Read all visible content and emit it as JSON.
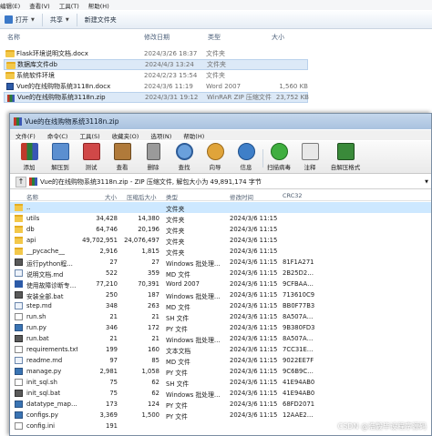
{
  "explorer": {
    "menu": [
      "编辑(E)",
      "查看(V)",
      "工具(T)",
      "帮助(H)"
    ],
    "toolbar": {
      "open": "打开",
      "share": "共享",
      "new_folder": "新建文件夹"
    },
    "columns": {
      "name": "名称",
      "date": "修改日期",
      "type": "类型",
      "size": "大小"
    },
    "rows": [
      {
        "name": "Flask环境说明文档.docx",
        "date": "2024/3/26 18:37",
        "type": "文件夹",
        "size": "",
        "icon": "folder-icon"
      },
      {
        "name": "数据库文件db",
        "date": "2024/4/3 13:24",
        "type": "文件夹",
        "size": "",
        "icon": "folder-icon"
      },
      {
        "name": "系统软件环境",
        "date": "2024/2/23 15:54",
        "type": "文件夹",
        "size": "",
        "icon": "folder-icon"
      },
      {
        "name": "Vue的在线购物系统3118n.docx",
        "date": "2024/3/6 11:19",
        "type": "Word 2007",
        "size": "1,560 KB",
        "icon": "docx-icon"
      },
      {
        "name": "Vue的在线购物系统3118n.zip",
        "date": "2024/3/31 19:12",
        "type": "WinRAR ZIP 压缩文件",
        "size": "23,752 KB",
        "icon": "zip-icon"
      }
    ]
  },
  "winrar": {
    "title": "Vue的在线购物系统3118n.zip",
    "menu": [
      "文件(F)",
      "命令(C)",
      "工具(S)",
      "收藏夹(O)",
      "选项(N)",
      "帮助(H)"
    ],
    "tools": [
      {
        "label": "添加",
        "color": "#b34a3a"
      },
      {
        "label": "解压到",
        "color": "#4f7fbf"
      },
      {
        "label": "测试",
        "color": "#c23b3b"
      },
      {
        "label": "查看",
        "color": "#9a6a2e"
      },
      {
        "label": "删除",
        "color": "#7a7a7a"
      },
      {
        "label": "查找",
        "color": "#4a7dc0"
      },
      {
        "label": "向导",
        "color": "#c88a2a"
      },
      {
        "label": "信息",
        "color": "#2f6fb3"
      },
      {
        "label": "扫描病毒",
        "color": "#3a9a3a"
      },
      {
        "label": "注释",
        "color": "#8a8a8a"
      },
      {
        "label": "自解压格式",
        "color": "#2a7a2a"
      }
    ],
    "path": "Vue的在线购物系统3118n.zip - ZIP 压缩文件, 解包大小为 49,891,174 字节",
    "columns": {
      "name": "名称",
      "size": "大小",
      "packed": "压缩后大小",
      "type": "类型",
      "modified": "修改时间",
      "crc": "CRC32"
    },
    "rows": [
      {
        "name": "..",
        "size": "",
        "packed": "",
        "type": "文件夹",
        "modified": "",
        "crc": "",
        "icon": "folder"
      },
      {
        "name": "utils",
        "size": "34,428",
        "packed": "14,380",
        "type": "文件夹",
        "modified": "2024/3/6 11:15",
        "crc": "",
        "icon": "folder"
      },
      {
        "name": "db",
        "size": "64,746",
        "packed": "20,196",
        "type": "文件夹",
        "modified": "2024/3/6 11:15",
        "crc": "",
        "icon": "folder"
      },
      {
        "name": "api",
        "size": "49,702,951",
        "packed": "24,076,497",
        "type": "文件夹",
        "modified": "2024/3/6 11:15",
        "crc": "",
        "icon": "folder"
      },
      {
        "name": "__pycache__",
        "size": "2,916",
        "packed": "1,815",
        "type": "文件夹",
        "modified": "2024/3/6 11:15",
        "crc": "",
        "icon": "folder"
      },
      {
        "name": "运行python程…",
        "size": "27",
        "packed": "27",
        "type": "Windows 批处理…",
        "modified": "2024/3/6 11:15",
        "crc": "81F1A271",
        "icon": "bat"
      },
      {
        "name": "说明文档.md",
        "size": "522",
        "packed": "359",
        "type": "MD 文件",
        "modified": "2024/3/6 11:15",
        "crc": "2B25D2…",
        "icon": "md"
      },
      {
        "name": "使用故障诊断专…",
        "size": "77,210",
        "packed": "70,391",
        "type": "Word 2007",
        "modified": "2024/3/6 11:15",
        "crc": "9CFBAA…",
        "icon": "doc"
      },
      {
        "name": "安装全部.bat",
        "size": "250",
        "packed": "187",
        "type": "Windows 批处理…",
        "modified": "2024/3/6 11:15",
        "crc": "713610C9",
        "icon": "bat"
      },
      {
        "name": "step.md",
        "size": "348",
        "packed": "263",
        "type": "MD 文件",
        "modified": "2024/3/6 11:15",
        "crc": "BB0F77B3",
        "icon": "md"
      },
      {
        "name": "run.sh",
        "size": "21",
        "packed": "21",
        "type": "SH 文件",
        "modified": "2024/3/6 11:15",
        "crc": "8A507A…",
        "icon": "file"
      },
      {
        "name": "run.py",
        "size": "346",
        "packed": "172",
        "type": "PY 文件",
        "modified": "2024/3/6 11:15",
        "crc": "9B380FD3",
        "icon": "py"
      },
      {
        "name": "run.bat",
        "size": "21",
        "packed": "21",
        "type": "Windows 批处理…",
        "modified": "2024/3/6 11:15",
        "crc": "8A507A…",
        "icon": "bat"
      },
      {
        "name": "requirements.txt",
        "size": "199",
        "packed": "160",
        "type": "文本文档",
        "modified": "2024/3/6 11:15",
        "crc": "7CC31E…",
        "icon": "file"
      },
      {
        "name": "readme.md",
        "size": "97",
        "packed": "85",
        "type": "MD 文件",
        "modified": "2024/3/6 11:15",
        "crc": "9022EE7F",
        "icon": "md"
      },
      {
        "name": "manage.py",
        "size": "2,981",
        "packed": "1,058",
        "type": "PY 文件",
        "modified": "2024/3/6 11:15",
        "crc": "9C6B9C…",
        "icon": "py"
      },
      {
        "name": "init_sql.sh",
        "size": "75",
        "packed": "62",
        "type": "SH 文件",
        "modified": "2024/3/6 11:15",
        "crc": "41E94AB0",
        "icon": "file"
      },
      {
        "name": "init_sql.bat",
        "size": "75",
        "packed": "62",
        "type": "Windows 批处理…",
        "modified": "2024/3/6 11:15",
        "crc": "41E94AB0",
        "icon": "bat"
      },
      {
        "name": "datatype_map…",
        "size": "173",
        "packed": "124",
        "type": "PY 文件",
        "modified": "2024/3/6 11:15",
        "crc": "68FD2071",
        "icon": "py"
      },
      {
        "name": "configs.py",
        "size": "3,369",
        "packed": "1,500",
        "type": "PY 文件",
        "modified": "2024/3/6 11:15",
        "crc": "12AAE2…",
        "icon": "py"
      },
      {
        "name": "config.ini",
        "size": "191",
        "packed": "",
        "type": "",
        "modified": "",
        "crc": "",
        "icon": "file"
      }
    ]
  },
  "watermark": "CSDN @浩毅毕设程序源码"
}
